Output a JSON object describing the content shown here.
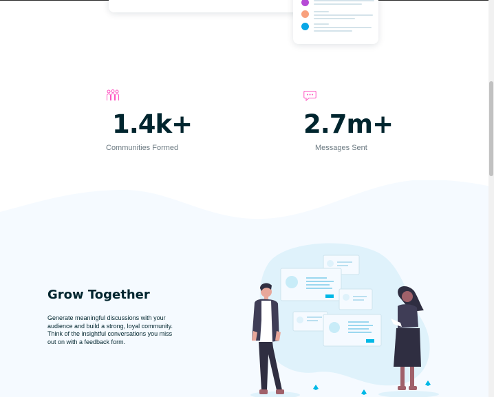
{
  "stats": [
    {
      "number": "1.4k+",
      "label": "Communities Formed",
      "icon": "communities-icon"
    },
    {
      "number": "2.7m+",
      "label": "Messages Sent",
      "icon": "messages-icon"
    }
  ],
  "grow": {
    "title": "Grow Together",
    "text": "Generate meaningful discussions with your audience and build a strong, loyal community. Think of the insightful conversations you miss out on with a feedback form."
  },
  "colors": {
    "heading": "#00252e",
    "muted": "#6c7a82",
    "accent_pink": "#ff52c1",
    "light_bg": "#f5faff",
    "cyan": "#00b8e6"
  }
}
